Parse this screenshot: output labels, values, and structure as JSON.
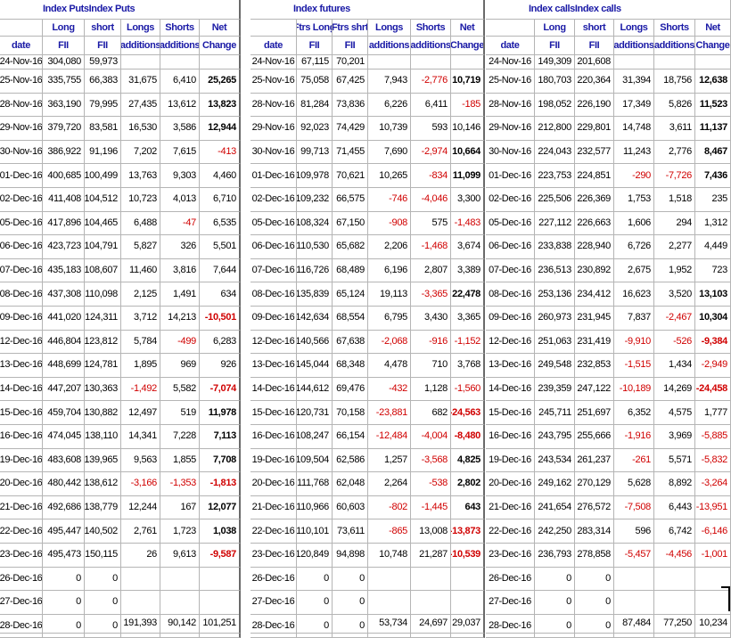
{
  "sections": [
    {
      "title": "Index PutsIndex Puts",
      "headers": {
        "top": [
          "",
          "Long",
          "short",
          "Longs",
          "Shorts",
          "Net"
        ],
        "bottom": [
          "date",
          "FII",
          "FII",
          "additions",
          "additions",
          "Change"
        ]
      },
      "rows": [
        [
          "24-Nov-16",
          "304,080",
          "59,973",
          "",
          "",
          ""
        ],
        [
          "25-Nov-16",
          "335,755",
          "66,383",
          "31,675",
          "6,410",
          "25,265"
        ],
        [
          "28-Nov-16",
          "363,190",
          "79,995",
          "27,435",
          "13,612",
          "13,823"
        ],
        [
          "29-Nov-16",
          "379,720",
          "83,581",
          "16,530",
          "3,586",
          "12,944"
        ],
        [
          "30-Nov-16",
          "386,922",
          "91,196",
          "7,202",
          "7,615",
          "-413"
        ],
        [
          "01-Dec-16",
          "400,685",
          "100,499",
          "13,763",
          "9,303",
          "4,460"
        ],
        [
          "02-Dec-16",
          "411,408",
          "104,512",
          "10,723",
          "4,013",
          "6,710"
        ],
        [
          "05-Dec-16",
          "417,896",
          "104,465",
          "6,488",
          "-47",
          "6,535"
        ],
        [
          "06-Dec-16",
          "423,723",
          "104,791",
          "5,827",
          "326",
          "5,501"
        ],
        [
          "07-Dec-16",
          "435,183",
          "108,607",
          "11,460",
          "3,816",
          "7,644"
        ],
        [
          "08-Dec-16",
          "437,308",
          "110,098",
          "2,125",
          "1,491",
          "634"
        ],
        [
          "09-Dec-16",
          "441,020",
          "124,311",
          "3,712",
          "14,213",
          "-10,501"
        ],
        [
          "12-Dec-16",
          "446,804",
          "123,812",
          "5,784",
          "-499",
          "6,283"
        ],
        [
          "13-Dec-16",
          "448,699",
          "124,781",
          "1,895",
          "969",
          "926"
        ],
        [
          "14-Dec-16",
          "447,207",
          "130,363",
          "-1,492",
          "5,582",
          "-7,074"
        ],
        [
          "15-Dec-16",
          "459,704",
          "130,882",
          "12,497",
          "519",
          "11,978"
        ],
        [
          "16-Dec-16",
          "474,045",
          "138,110",
          "14,341",
          "7,228",
          "7,113"
        ],
        [
          "19-Dec-16",
          "483,608",
          "139,965",
          "9,563",
          "1,855",
          "7,708"
        ],
        [
          "20-Dec-16",
          "480,442",
          "138,612",
          "-3,166",
          "-1,353",
          "-1,813"
        ],
        [
          "21-Dec-16",
          "492,686",
          "138,779",
          "12,244",
          "167",
          "12,077"
        ],
        [
          "22-Dec-16",
          "495,447",
          "140,502",
          "2,761",
          "1,723",
          "1,038"
        ],
        [
          "23-Dec-16",
          "495,473",
          "150,115",
          "26",
          "9,613",
          "-9,587"
        ],
        [
          "26-Dec-16",
          "0",
          "0",
          "",
          "",
          ""
        ],
        [
          "27-Dec-16",
          "0",
          "0",
          "",
          "",
          ""
        ],
        [
          "28-Dec-16",
          "0",
          "0",
          "",
          "",
          ""
        ]
      ],
      "totals": [
        "",
        "",
        "",
        "191,393",
        "90,142",
        "101,251"
      ],
      "bold_net": [
        1,
        2,
        3,
        11,
        14,
        15,
        16,
        17,
        18,
        19,
        20,
        21
      ]
    },
    {
      "title": "Index futures",
      "headers": {
        "top": [
          "",
          "Ftrs Long",
          "Ftrs shrt",
          "Longs",
          "Shorts",
          "Net"
        ],
        "bottom": [
          "date",
          "FII",
          "FII",
          "additions",
          "additions",
          "Change"
        ]
      },
      "rows": [
        [
          "24-Nov-16",
          "67,115",
          "70,201",
          "",
          "",
          ""
        ],
        [
          "25-Nov-16",
          "75,058",
          "67,425",
          "7,943",
          "-2,776",
          "10,719"
        ],
        [
          "28-Nov-16",
          "81,284",
          "73,836",
          "6,226",
          "6,411",
          "-185"
        ],
        [
          "29-Nov-16",
          "92,023",
          "74,429",
          "10,739",
          "593",
          "10,146"
        ],
        [
          "30-Nov-16",
          "99,713",
          "71,455",
          "7,690",
          "-2,974",
          "10,664"
        ],
        [
          "01-Dec-16",
          "109,978",
          "70,621",
          "10,265",
          "-834",
          "11,099"
        ],
        [
          "02-Dec-16",
          "109,232",
          "66,575",
          "-746",
          "-4,046",
          "3,300"
        ],
        [
          "05-Dec-16",
          "108,324",
          "67,150",
          "-908",
          "575",
          "-1,483"
        ],
        [
          "06-Dec-16",
          "110,530",
          "65,682",
          "2,206",
          "-1,468",
          "3,674"
        ],
        [
          "07-Dec-16",
          "116,726",
          "68,489",
          "6,196",
          "2,807",
          "3,389"
        ],
        [
          "08-Dec-16",
          "135,839",
          "65,124",
          "19,113",
          "-3,365",
          "22,478"
        ],
        [
          "09-Dec-16",
          "142,634",
          "68,554",
          "6,795",
          "3,430",
          "3,365"
        ],
        [
          "12-Dec-16",
          "140,566",
          "67,638",
          "-2,068",
          "-916",
          "-1,152"
        ],
        [
          "13-Dec-16",
          "145,044",
          "68,348",
          "4,478",
          "710",
          "3,768"
        ],
        [
          "14-Dec-16",
          "144,612",
          "69,476",
          "-432",
          "1,128",
          "-1,560"
        ],
        [
          "15-Dec-16",
          "120,731",
          "70,158",
          "-23,881",
          "682",
          "-24,563"
        ],
        [
          "16-Dec-16",
          "108,247",
          "66,154",
          "-12,484",
          "-4,004",
          "-8,480"
        ],
        [
          "19-Dec-16",
          "109,504",
          "62,586",
          "1,257",
          "-3,568",
          "4,825"
        ],
        [
          "20-Dec-16",
          "111,768",
          "62,048",
          "2,264",
          "-538",
          "2,802"
        ],
        [
          "21-Dec-16",
          "110,966",
          "60,603",
          "-802",
          "-1,445",
          "643"
        ],
        [
          "22-Dec-16",
          "110,101",
          "73,611",
          "-865",
          "13,008",
          "-13,873"
        ],
        [
          "23-Dec-16",
          "120,849",
          "94,898",
          "10,748",
          "21,287",
          "-10,539"
        ],
        [
          "26-Dec-16",
          "0",
          "0",
          "",
          "",
          ""
        ],
        [
          "27-Dec-16",
          "0",
          "0",
          "",
          "",
          ""
        ],
        [
          "28-Dec-16",
          "0",
          "0",
          "",
          "",
          ""
        ]
      ],
      "totals": [
        "",
        "",
        "",
        "53,734",
        "24,697",
        "29,037"
      ],
      "bold_net": [
        1,
        4,
        5,
        10,
        15,
        16,
        17,
        18,
        19,
        20,
        21
      ]
    },
    {
      "title": "Index callsIndex calls",
      "headers": {
        "top": [
          "",
          "Long",
          "short",
          "Longs",
          "Shorts",
          "Net"
        ],
        "bottom": [
          "date",
          "FII",
          "FII",
          "additions",
          "additions",
          "Change"
        ]
      },
      "rows": [
        [
          "24-Nov-16",
          "149,309",
          "201,608",
          "",
          "",
          ""
        ],
        [
          "25-Nov-16",
          "180,703",
          "220,364",
          "31,394",
          "18,756",
          "12,638"
        ],
        [
          "28-Nov-16",
          "198,052",
          "226,190",
          "17,349",
          "5,826",
          "11,523"
        ],
        [
          "29-Nov-16",
          "212,800",
          "229,801",
          "14,748",
          "3,611",
          "11,137"
        ],
        [
          "30-Nov-16",
          "224,043",
          "232,577",
          "11,243",
          "2,776",
          "8,467"
        ],
        [
          "01-Dec-16",
          "223,753",
          "224,851",
          "-290",
          "-7,726",
          "7,436"
        ],
        [
          "02-Dec-16",
          "225,506",
          "226,369",
          "1,753",
          "1,518",
          "235"
        ],
        [
          "05-Dec-16",
          "227,112",
          "226,663",
          "1,606",
          "294",
          "1,312"
        ],
        [
          "06-Dec-16",
          "233,838",
          "228,940",
          "6,726",
          "2,277",
          "4,449"
        ],
        [
          "07-Dec-16",
          "236,513",
          "230,892",
          "2,675",
          "1,952",
          "723"
        ],
        [
          "08-Dec-16",
          "253,136",
          "234,412",
          "16,623",
          "3,520",
          "13,103"
        ],
        [
          "09-Dec-16",
          "260,973",
          "231,945",
          "7,837",
          "-2,467",
          "10,304"
        ],
        [
          "12-Dec-16",
          "251,063",
          "231,419",
          "-9,910",
          "-526",
          "-9,384"
        ],
        [
          "13-Dec-16",
          "249,548",
          "232,853",
          "-1,515",
          "1,434",
          "-2,949"
        ],
        [
          "14-Dec-16",
          "239,359",
          "247,122",
          "-10,189",
          "14,269",
          "-24,458"
        ],
        [
          "15-Dec-16",
          "245,711",
          "251,697",
          "6,352",
          "4,575",
          "1,777"
        ],
        [
          "16-Dec-16",
          "243,795",
          "255,666",
          "-1,916",
          "3,969",
          "-5,885"
        ],
        [
          "19-Dec-16",
          "243,534",
          "261,237",
          "-261",
          "5,571",
          "-5,832"
        ],
        [
          "20-Dec-16",
          "249,162",
          "270,129",
          "5,628",
          "8,892",
          "-3,264"
        ],
        [
          "21-Dec-16",
          "241,654",
          "276,572",
          "-7,508",
          "6,443",
          "-13,951"
        ],
        [
          "22-Dec-16",
          "242,250",
          "283,314",
          "596",
          "6,742",
          "-6,146"
        ],
        [
          "23-Dec-16",
          "236,793",
          "278,858",
          "-5,457",
          "-4,456",
          "-1,001"
        ],
        [
          "26-Dec-16",
          "0",
          "0",
          "",
          "",
          ""
        ],
        [
          "27-Dec-16",
          "0",
          "0",
          "",
          "",
          ""
        ],
        [
          "28-Dec-16",
          "0",
          "0",
          "",
          "",
          ""
        ]
      ],
      "totals": [
        "",
        "",
        "",
        "87,484",
        "77,250",
        "10,234"
      ],
      "bold_net": [
        1,
        2,
        3,
        4,
        5,
        10,
        11,
        12,
        14
      ]
    }
  ],
  "colors": {
    "header_text": "#1a1aa6",
    "negative": "#d00000",
    "gridline": "#b5b5b5"
  }
}
